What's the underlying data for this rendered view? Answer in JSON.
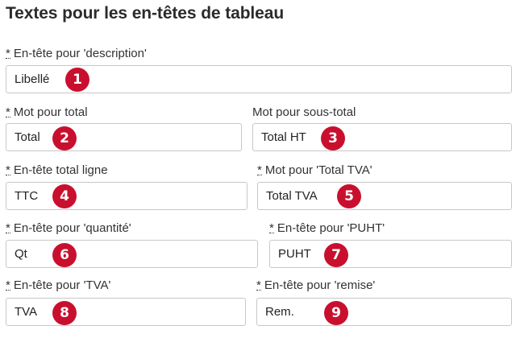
{
  "section_title": "Textes pour les en-têtes de tableau",
  "required_marker": "*",
  "fields": [
    {
      "label": "En-tête pour 'description'",
      "value": "Libellé",
      "badge": "1",
      "required": true
    },
    {
      "label": "Mot pour total",
      "value": "Total",
      "badge": "2",
      "required": true
    },
    {
      "label": "Mot pour sous-total",
      "value": "Total HT",
      "badge": "3",
      "required": false
    },
    {
      "label": "En-tête total ligne",
      "value": "TTC",
      "badge": "4",
      "required": true
    },
    {
      "label": "Mot pour 'Total TVA'",
      "value": "Total TVA",
      "badge": "5",
      "required": true
    },
    {
      "label": "En-tête pour 'quantité'",
      "value": "Qt",
      "badge": "6",
      "required": true
    },
    {
      "label": "En-tête pour 'PUHT'",
      "value": "PUHT",
      "badge": "7",
      "required": true
    },
    {
      "label": "En-tête pour 'TVA'",
      "value": "TVA",
      "badge": "8",
      "required": true
    },
    {
      "label": "En-tête pour 'remise'",
      "value": "Rem.",
      "badge": "9",
      "required": true
    }
  ],
  "colors": {
    "badge_background": "#c8102e",
    "badge_text": "#ffffff",
    "input_border": "#c8c8c8"
  }
}
